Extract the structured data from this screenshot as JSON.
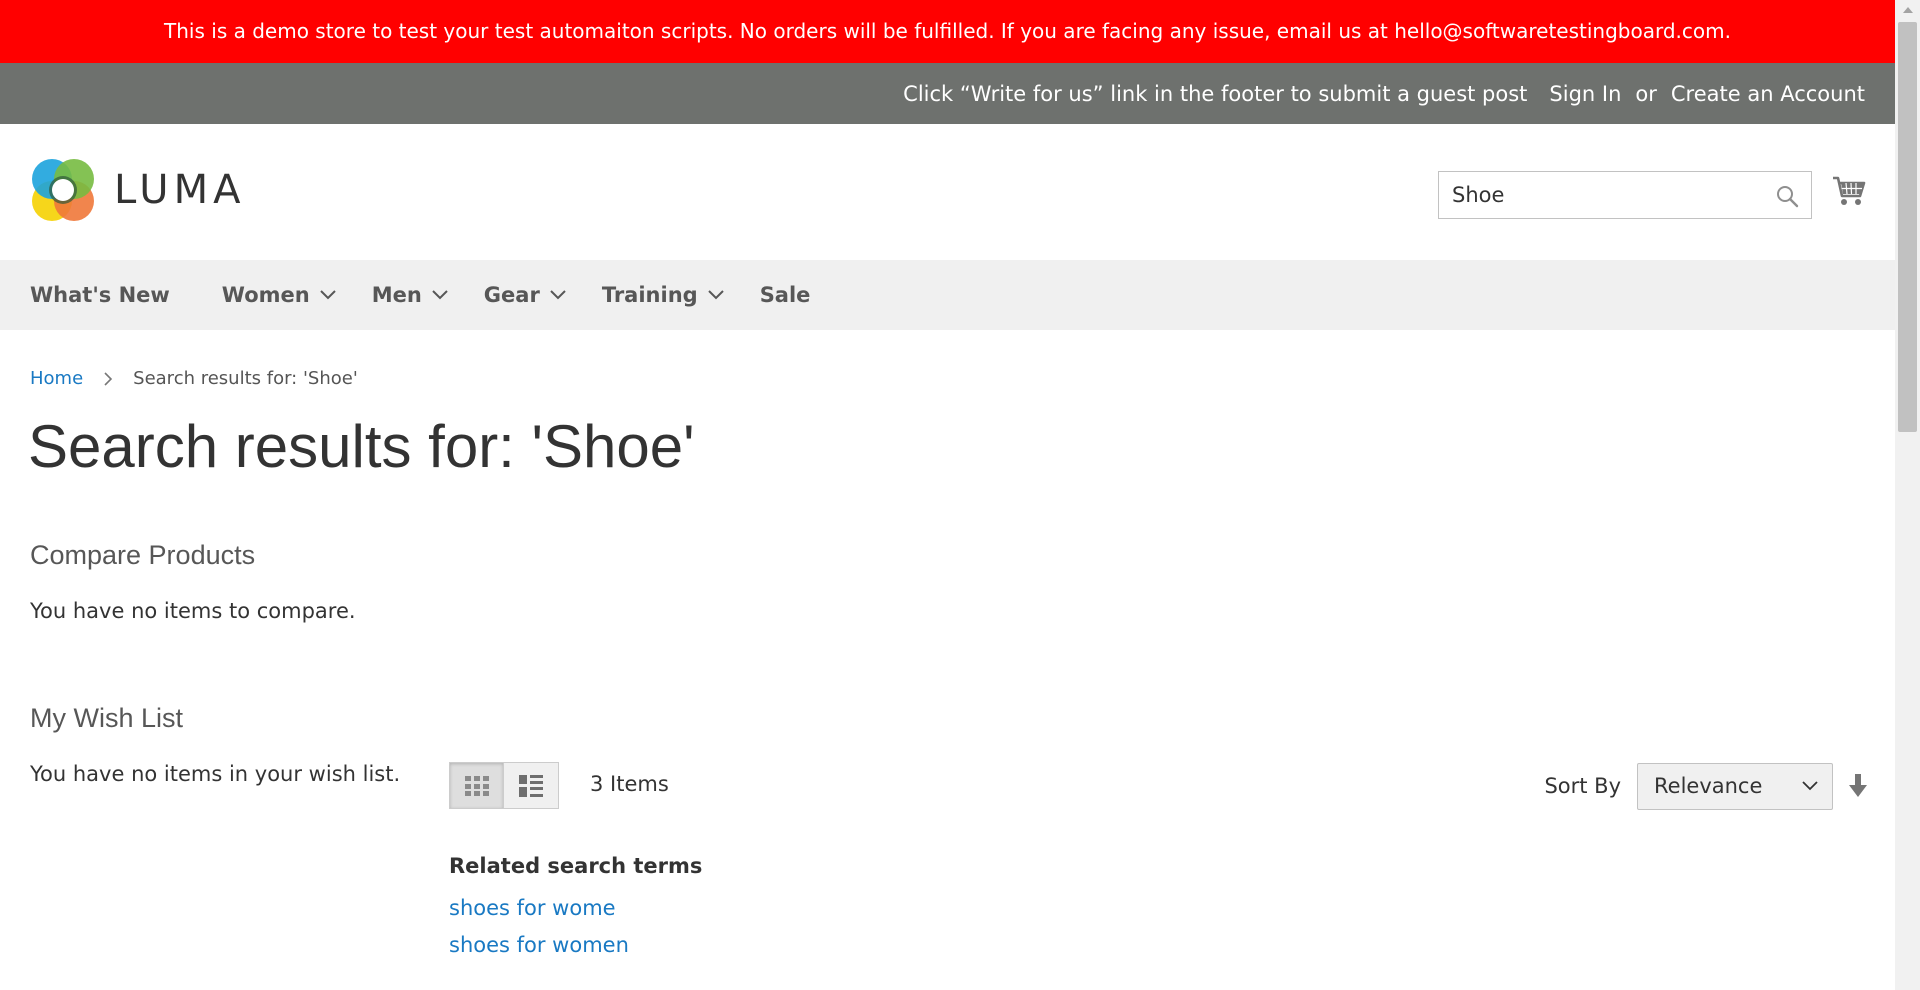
{
  "banner": {
    "text": "This is a demo store to test your test automaiton scripts. No orders will be fulfilled. If you are facing any issue, email us at hello@softwaretestingboard.com."
  },
  "top_bar": {
    "guest_note": "Click “Write for us” link in the footer to submit a guest post",
    "sign_in": "Sign In",
    "or": "or",
    "create_account": "Create an Account"
  },
  "header": {
    "logo_text": "LUMA",
    "search_value": "Shoe",
    "icons": {
      "search": "search-icon",
      "cart": "cart-icon"
    }
  },
  "nav": {
    "items": [
      {
        "label": "What's New",
        "has_menu": false
      },
      {
        "label": "Women",
        "has_menu": true
      },
      {
        "label": "Men",
        "has_menu": true
      },
      {
        "label": "Gear",
        "has_menu": true
      },
      {
        "label": "Training",
        "has_menu": true
      },
      {
        "label": "Sale",
        "has_menu": false
      }
    ]
  },
  "breadcrumb": {
    "home": "Home",
    "current": "Search results for: 'Shoe'"
  },
  "page_title": "Search results for: 'Shoe'",
  "sidebar": {
    "compare_title": "Compare Products",
    "compare_empty": "You have no items to compare.",
    "wishlist_title": "My Wish List",
    "wishlist_empty": "You have no items in your wish list."
  },
  "toolbar": {
    "items_count": "3 Items",
    "sort_label": "Sort By",
    "sort_value": "Relevance",
    "modes": [
      "grid",
      "list"
    ]
  },
  "related": {
    "title": "Related search terms",
    "terms": [
      "shoes for wome",
      "shoes for women"
    ]
  },
  "colors": {
    "banner_bg": "#ff0000",
    "top_bar_bg": "#6e716e",
    "nav_bg": "#f0f0f0",
    "link": "#1979c3"
  }
}
